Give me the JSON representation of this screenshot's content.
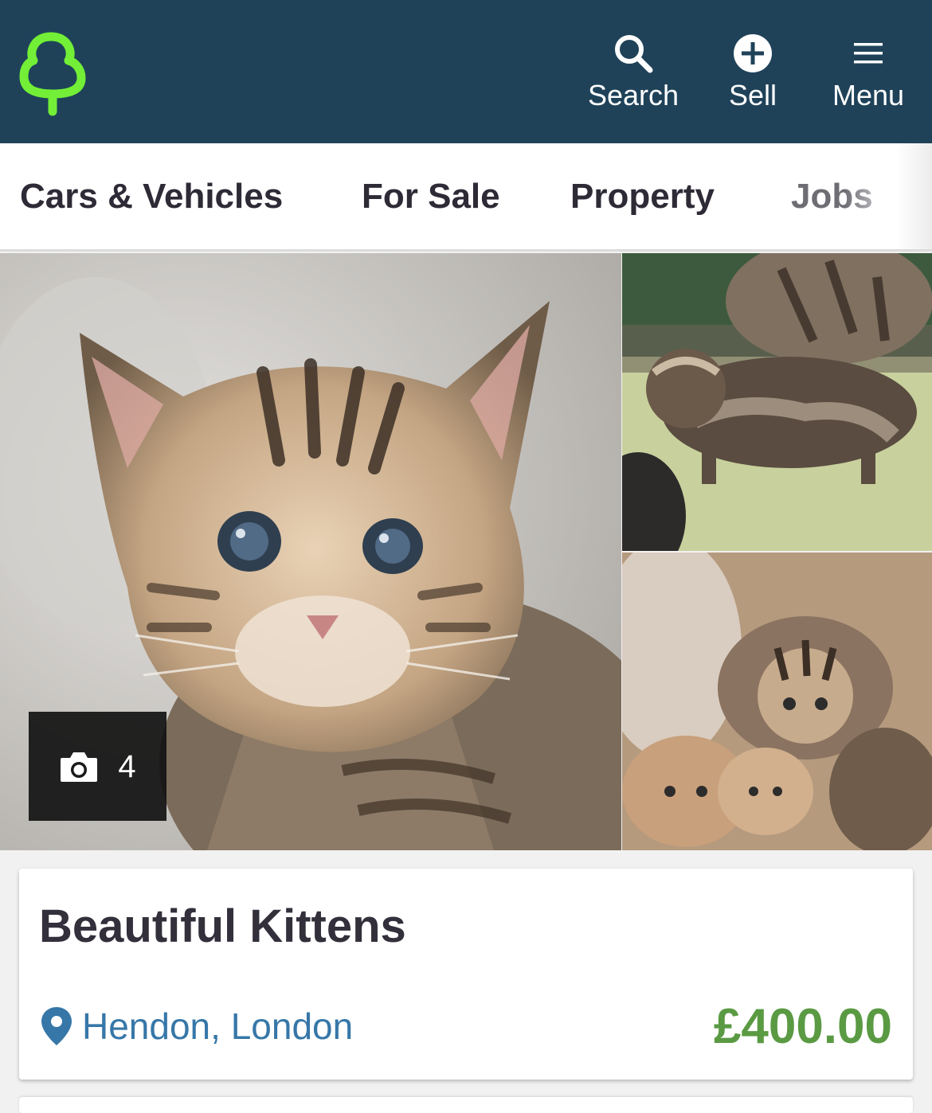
{
  "header": {
    "logo_icon": "tree-logo-icon",
    "actions": [
      {
        "label": "Search",
        "icon": "search-icon"
      },
      {
        "label": "Sell",
        "icon": "plus-circle-icon"
      },
      {
        "label": "Menu",
        "icon": "hamburger-menu-icon"
      }
    ],
    "colors": {
      "background": "#1f4259",
      "logo": "#72ef36"
    }
  },
  "categories": [
    {
      "label": "Cars & Vehicles"
    },
    {
      "label": "For Sale"
    },
    {
      "label": "Property"
    },
    {
      "label": "Jobs"
    }
  ],
  "gallery": {
    "photo_count": "4",
    "camera_icon": "camera-icon"
  },
  "listing": {
    "title": "Beautiful Kittens",
    "location": "Hendon, London",
    "location_icon": "map-pin-icon",
    "price": "£400.00",
    "colors": {
      "location": "#3677a8",
      "price": "#5a9a43"
    }
  }
}
